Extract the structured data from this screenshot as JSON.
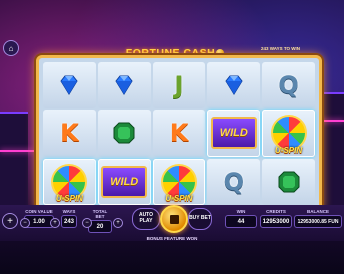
{
  "game": {
    "title": "FORTUNE CASH",
    "ways_text": "243 WAYS TO WIN"
  },
  "reels": [
    [
      "blue-diamond",
      "K",
      "U-SPIN"
    ],
    [
      "blue-diamond",
      "green-emerald",
      "WILD"
    ],
    [
      "J",
      "K",
      "U-SPIN"
    ],
    [
      "blue-diamond",
      "WILD",
      "Q"
    ],
    [
      "Q",
      "U-SPIN",
      "green-emerald"
    ]
  ],
  "labels": {
    "wild": "WILD",
    "uspin": "U-SPIN"
  },
  "controls": {
    "coin_value_label": "COIN VALUE",
    "coin_value": "1.00",
    "ways_label": "WAYS",
    "ways_value": "243",
    "total_bet_label": "TOTAL BET",
    "total_bet_value": "20",
    "auto_play_label": "AUTO PLAY",
    "buy_bet_label": "BUY BET",
    "win_label": "WIN",
    "win_value": "44",
    "credits_label": "CREDITS",
    "credits_value": "12953000",
    "balance_label": "BALANCE",
    "balance_value": "12953000.85 FUN",
    "bonus_text": "BONUS FEATURE WON"
  },
  "colors": {
    "frame": "#f2b84b",
    "title": "#ffd84a",
    "neon_pink": "#ff3fd2"
  }
}
